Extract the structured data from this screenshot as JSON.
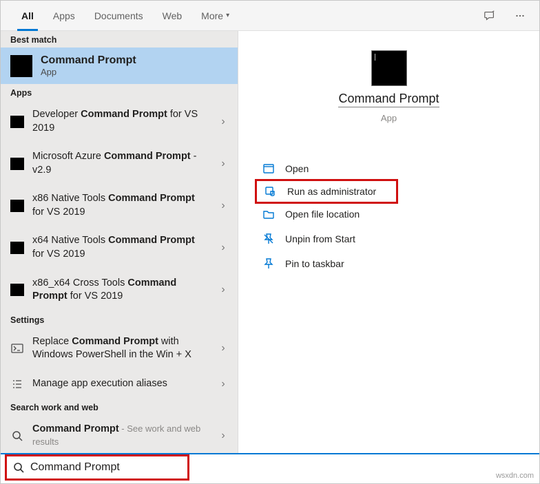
{
  "tabs": {
    "all": "All",
    "apps": "Apps",
    "documents": "Documents",
    "web": "Web",
    "more": "More"
  },
  "sections": {
    "best_match": "Best match",
    "apps": "Apps",
    "settings": "Settings",
    "search_web": "Search work and web"
  },
  "best_match_result": {
    "title": "Command Prompt",
    "subtitle": "App"
  },
  "apps_results": [
    {
      "pre": "Developer ",
      "bold": "Command Prompt",
      "post": " for VS 2019"
    },
    {
      "pre": "Microsoft Azure ",
      "bold": "Command Prompt",
      "post": " - v2.9"
    },
    {
      "pre": "x86 Native Tools ",
      "bold": "Command Prompt",
      "post": " for VS 2019"
    },
    {
      "pre": "x64 Native Tools ",
      "bold": "Command Prompt",
      "post": " for VS 2019"
    },
    {
      "pre": "x86_x64 Cross Tools ",
      "bold": "Command Prompt",
      "post": " for VS 2019"
    }
  ],
  "settings_results": [
    {
      "pre": "Replace ",
      "bold": "Command Prompt",
      "post": " with Windows PowerShell in the Win + X"
    },
    {
      "plain": "Manage app execution aliases"
    }
  ],
  "web_results": [
    {
      "bold": "Command Prompt",
      "secondary": " - See work and web results"
    }
  ],
  "hero": {
    "title": "Command Prompt",
    "subtitle": "App"
  },
  "actions": {
    "open": "Open",
    "run_admin": "Run as administrator",
    "open_location": "Open file location",
    "unpin_start": "Unpin from Start",
    "pin_taskbar": "Pin to taskbar"
  },
  "search": {
    "value": "Command Prompt"
  },
  "watermark": "wsxdn.com"
}
